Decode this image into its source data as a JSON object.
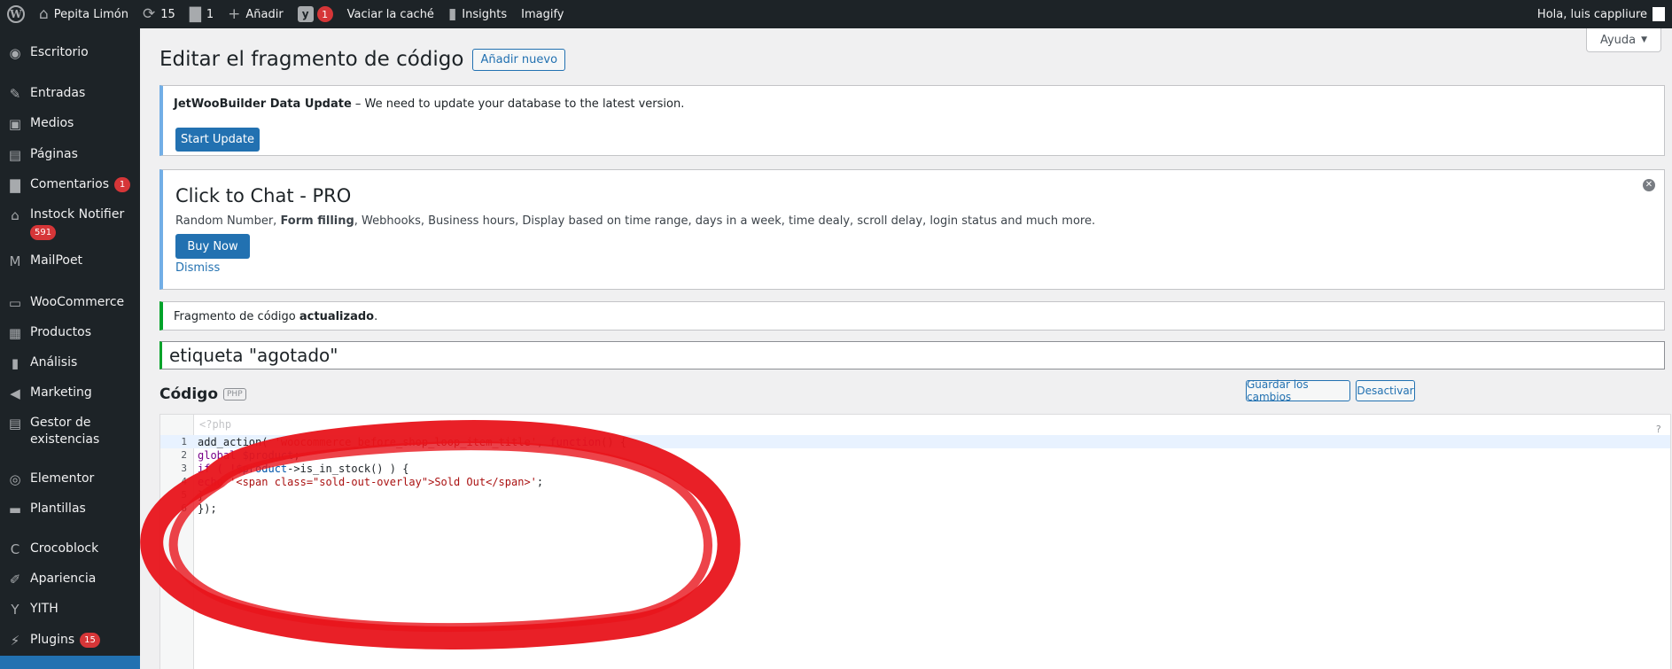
{
  "adminbar": {
    "site_name": "Pepita Limón",
    "updates_count": "15",
    "comments_count": "1",
    "add_new": "Añadir",
    "yoast_badge": "1",
    "clear_cache": "Vaciar la caché",
    "insights": "Insights",
    "imagify": "Imagify",
    "greeting": "Hola, luis cappliure"
  },
  "sidebar": {
    "items": [
      {
        "label": "Escritorio",
        "icon": "dashboard-icon"
      },
      {
        "label": "Entradas",
        "icon": "pin-icon"
      },
      {
        "label": "Medios",
        "icon": "media-icon"
      },
      {
        "label": "Páginas",
        "icon": "pages-icon"
      },
      {
        "label": "Comentarios",
        "icon": "comments-icon",
        "badge": "1"
      },
      {
        "label": "Instock Notifier",
        "icon": "notifier-icon",
        "badge": "591"
      },
      {
        "label": "MailPoet",
        "icon": "mailpoet-icon"
      },
      {
        "label": "WooCommerce",
        "icon": "woocommerce-icon"
      },
      {
        "label": "Productos",
        "icon": "products-icon"
      },
      {
        "label": "Análisis",
        "icon": "analytics-icon"
      },
      {
        "label": "Marketing",
        "icon": "marketing-icon"
      },
      {
        "label": "Gestor de existencias",
        "icon": "stock-icon"
      },
      {
        "label": "Elementor",
        "icon": "elementor-icon"
      },
      {
        "label": "Plantillas",
        "icon": "templates-icon"
      },
      {
        "label": "Crocoblock",
        "icon": "crocoblock-icon"
      },
      {
        "label": "Apariencia",
        "icon": "appearance-icon"
      },
      {
        "label": "YITH",
        "icon": "yith-icon"
      },
      {
        "label": "Plugins",
        "icon": "plugins-icon",
        "badge": "15"
      }
    ]
  },
  "header": {
    "help_label": "Ayuda",
    "page_title": "Editar el fragmento de código",
    "add_new_button": "Añadir nuevo"
  },
  "notices": {
    "jetwoo": {
      "bold": "JetWooBuilder Data Update",
      "text": " – We need to update your database to the latest version.",
      "button": "Start Update"
    },
    "chat": {
      "title": "Click to Chat - PRO",
      "desc_before": "Random Number, ",
      "desc_bold": "Form filling",
      "desc_after": ", Webhooks, Business hours, Display based on time range, days in a week, time dealy, scroll delay, login status and much more.",
      "button": "Buy Now",
      "dismiss": "Dismiss"
    },
    "updated": {
      "text": "Fragmento de código ",
      "bold": "actualizado",
      "end": "."
    }
  },
  "snippet": {
    "title": "etiqueta \"agotado\"",
    "code_label": "Código",
    "lang_badge": "PHP",
    "save_button": "Guardar los cambios",
    "deactivate_button": "Desactivar",
    "php_open": "<?php",
    "help_q": "?",
    "line_numbers": [
      "1",
      "2",
      "3",
      "4",
      "5",
      "6"
    ],
    "code": {
      "l1_a": "add_action( ",
      "l1_b": "'woocommerce_before_shop_loop_item_title'",
      "l1_c": ", ",
      "l1_d": "function",
      "l1_e": "() {",
      "l2_a": "global ",
      "l2_b": "$product",
      "l2_c": ";",
      "l3_a": "if ( !",
      "l3_b": "$product",
      "l3_c": "->is_in_stock() ) {",
      "l4_a": "echo ",
      "l4_b": "'<span class=\"sold-out-overlay\">Sold Out</span>'",
      "l4_c": ";",
      "l5": "}",
      "l6": "});"
    }
  },
  "colors": {
    "adminbar_bg": "#1d2327",
    "primary": "#2271b1",
    "badge": "#d63638",
    "success": "#00a32a",
    "annotation": "#e8141b"
  }
}
